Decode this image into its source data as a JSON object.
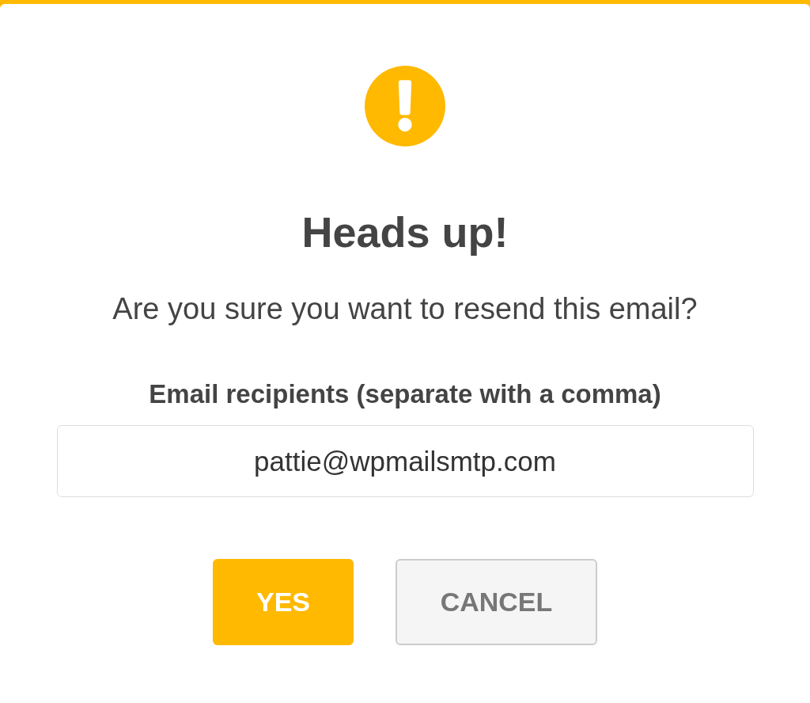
{
  "dialog": {
    "title": "Heads up!",
    "message": "Are you sure you want to resend this email?",
    "recipients_field": {
      "label": "Email recipients (separate with a comma)",
      "value": "pattie@wpmailsmtp.com"
    },
    "buttons": [
      {
        "label": "YES",
        "kind": "primary"
      },
      {
        "label": "CANCEL",
        "kind": "secondary"
      }
    ]
  }
}
